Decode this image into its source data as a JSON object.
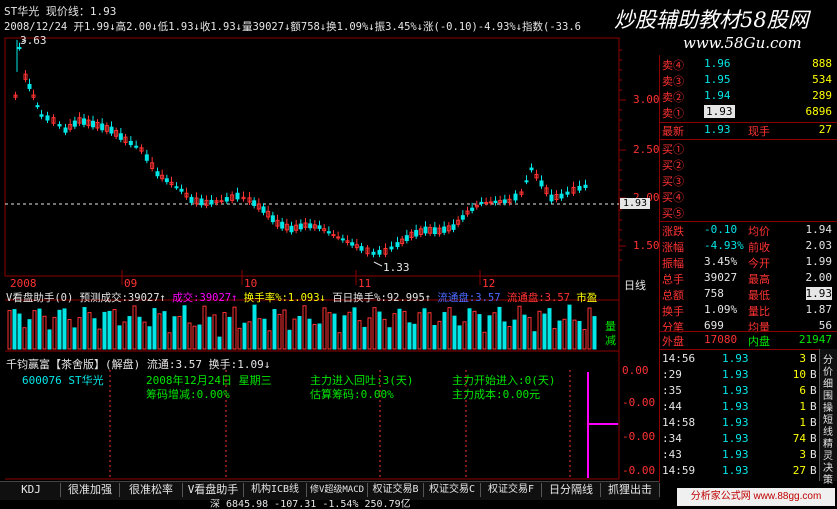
{
  "header": {
    "stock": "ST华光",
    "price_line_label": "现价线：1.93",
    "info": "2008/12/24 开1.99↓高2.00↓低1.93↓收1.93↓量39027↓额758↓换1.09%↓振3.45%↓涨(-0.10)-4.93%↓指数(-33.6",
    "watermark": "炒股辅助教材58股网",
    "watermark_url": "www.58Gu.com"
  },
  "price_chart": {
    "y_labels": [
      "3.00",
      "2.50",
      "2.00",
      "1.50"
    ],
    "high_label": "3.63",
    "low_label": "1.33",
    "current_tag": "1.93",
    "months": [
      "2008",
      "09",
      "10",
      "11",
      "12"
    ],
    "period": "日线"
  },
  "vol_panel": {
    "title_parts": [
      "V看盘助手(0) 预测成交:39027↑",
      "成交:39027↑",
      "换手率%:1.093↓",
      "百日换手%:92.995↑",
      "流通盘:3.57",
      "流通盘:3.57",
      "市盈"
    ],
    "right_labels": [
      "量",
      "减"
    ]
  },
  "ind_panel": {
    "title": "千钧赢富【茶舍版】(解盘) 流通:3.57 换手:1.09↓",
    "code": "600076 ST华光",
    "date": "2008年12月24日 星期三",
    "line2": "筹码增减:0.00%",
    "enter_days": "主力进入回吐:3(天)",
    "est": "估算筹码:0.00%",
    "start_days": "主力开始进入:0(天)",
    "cost": "主力成本:0.00元",
    "y_labels": [
      "0.00",
      "-0.00",
      "-0.00",
      "-0.00"
    ]
  },
  "tabs": [
    "KDJ",
    "很准加强",
    "很准松率",
    "V看盘助手",
    "机构ICB线",
    "修V超级MACD",
    "权证交易B",
    "权证交易C",
    "权证交易F",
    "日分隔线",
    "抓狸出击"
  ],
  "status": "深 6845.98 -107.31 -1.54% 250.79亿",
  "quote": {
    "asks": [
      {
        "label": "卖④",
        "price": "1.96",
        "vol": "888"
      },
      {
        "label": "卖③",
        "price": "1.95",
        "vol": "534"
      },
      {
        "label": "卖②",
        "price": "1.94",
        "vol": "289"
      },
      {
        "label": "卖①",
        "price": "1.93",
        "vol": "6896"
      }
    ],
    "last": {
      "label": "最新",
      "price": "1.93",
      "label2": "现手",
      "vol": "27"
    },
    "bids": [
      "买①",
      "买②",
      "买③",
      "买④",
      "买⑤"
    ],
    "stats": [
      {
        "l1": "涨跌",
        "v1": "-0.10",
        "l2": "均价",
        "v2": "1.94"
      },
      {
        "l1": "涨幅",
        "v1": "-4.93%",
        "l2": "前收",
        "v2": "2.03"
      },
      {
        "l1": "振幅",
        "v1": "3.45%",
        "l2": "今开",
        "v2": "1.99"
      },
      {
        "l1": "总手",
        "v1": "39027",
        "l2": "最高",
        "v2": "2.00"
      },
      {
        "l1": "总额",
        "v1": "758",
        "l2": "最低",
        "v2": "1.93"
      },
      {
        "l1": "换手",
        "v1": "1.09%",
        "l2": "量比",
        "v2": "1.87"
      },
      {
        "l1": "分笔",
        "v1": "699",
        "l2": "均量",
        "v2": "56"
      }
    ],
    "outer": {
      "l1": "外盘",
      "v1": "17080",
      "l2": "内盘",
      "v2": "21947"
    }
  },
  "ticks": [
    {
      "time": "14:56",
      "price": "1.93",
      "vol": "3",
      "side": "B"
    },
    {
      "time": ":29",
      "price": "1.93",
      "vol": "10",
      "side": "B"
    },
    {
      "time": ":35",
      "price": "1.93",
      "vol": "6",
      "side": "B"
    },
    {
      "time": ":44",
      "price": "1.93",
      "vol": "1",
      "side": "B"
    },
    {
      "time": "14:58",
      "price": "1.93",
      "vol": "1",
      "side": "B"
    },
    {
      "time": ":34",
      "price": "1.93",
      "vol": "74",
      "side": "B"
    },
    {
      "time": ":43",
      "price": "1.93",
      "vol": "3",
      "side": "B"
    },
    {
      "time": "14:59",
      "price": "1.93",
      "vol": "27",
      "side": "B"
    }
  ],
  "right_tabs": [
    "分",
    "价",
    "细",
    "围",
    "操",
    "短",
    "线",
    "精",
    "灵",
    "决",
    "策"
  ],
  "footer_watermark": "分析家公式网 www.88gg.com",
  "colors": {
    "up": "#ff3232",
    "down": "#00e6e6",
    "bg": "#000000",
    "grid": "#8b0000"
  }
}
